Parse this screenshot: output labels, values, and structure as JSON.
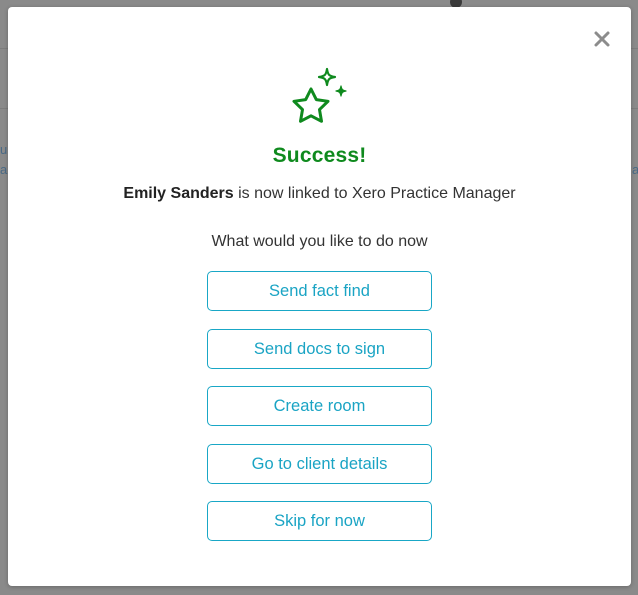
{
  "background": {
    "left_fragment_1": "u",
    "left_fragment_2": "a",
    "right_fragment": "a"
  },
  "modal": {
    "close_label": "×",
    "success_icon": "sparkle-star-icon",
    "title": "Success!",
    "client_name": "Emily Sanders",
    "linked_text": " is now linked to Xero Practice Manager",
    "prompt": "What would you like to do now",
    "actions": [
      {
        "label": "Send fact find"
      },
      {
        "label": "Send docs to sign"
      },
      {
        "label": "Create room"
      },
      {
        "label": "Go to client details"
      },
      {
        "label": "Skip for now"
      }
    ]
  },
  "colors": {
    "success": "#0f8a1e",
    "accent": "#19a7c6",
    "overlay": "#8a8a8a"
  }
}
